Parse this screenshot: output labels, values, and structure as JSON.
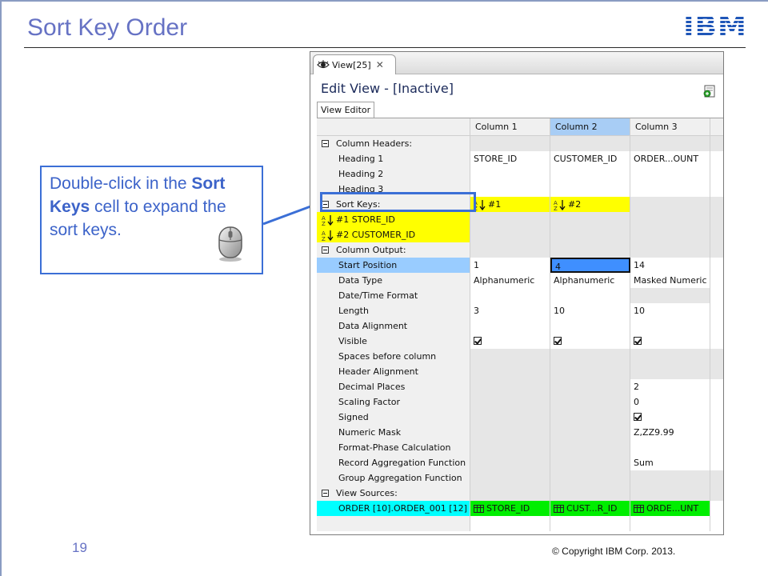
{
  "slide": {
    "title": "Sort Key Order",
    "logo_text": "IBM",
    "page_number": "19",
    "copyright": "© Copyright  IBM Corp. 2013."
  },
  "callout": {
    "text_1": "Double-click in the ",
    "bold_1": "Sort Keys",
    "text_2": " cell to expand the sort keys."
  },
  "app": {
    "tab_label": "View[25]",
    "tab_close": "✕",
    "edit_title": "Edit View - [Inactive]",
    "subtab_label": "View Editor",
    "columns": [
      "Column 1",
      "Column 2",
      "Column 3"
    ],
    "rows": {
      "column_headers": "Column Headers:",
      "heading1": "Heading 1",
      "heading1_values": [
        "STORE_ID",
        "CUSTOMER_ID",
        "ORDER...OUNT"
      ],
      "heading2": "Heading 2",
      "heading3": "Heading 3",
      "sort_keys": "Sort Keys:",
      "sort_key_col1": "#1",
      "sort_key_col2": "#2",
      "sort_key1": "#1 STORE_ID",
      "sort_key2": "#2 CUSTOMER_ID",
      "column_output": "Column Output:",
      "start_position": "Start Position",
      "start_position_values": [
        "1",
        "4",
        "14"
      ],
      "data_type": "Data Type",
      "data_type_values": [
        "Alphanumeric",
        "Alphanumeric",
        "Masked Numeric"
      ],
      "date_time_format": "Date/Time Format",
      "length": "Length",
      "length_values": [
        "3",
        "10",
        "10"
      ],
      "data_alignment": "Data Alignment",
      "visible": "Visible",
      "spaces_before": "Spaces before column",
      "header_alignment": "Header Alignment",
      "decimal_places": "Decimal Places",
      "decimal_places_value": "2",
      "scaling_factor": "Scaling Factor",
      "scaling_factor_value": "0",
      "signed": "Signed",
      "numeric_mask": "Numeric Mask",
      "numeric_mask_value": "Z,ZZ9.99",
      "format_phase": "Format-Phase Calculation",
      "record_agg": "Record Aggregation Function",
      "record_agg_value": "Sum",
      "group_agg": "Group Aggregation Function",
      "view_sources": "View Sources:",
      "view_source_label": "ORDER [10].ORDER_001 [12]",
      "view_source_values": [
        "STORE_ID",
        "CUST...R_ID",
        "ORDE...UNT"
      ]
    }
  },
  "colors": {
    "title": "#6672c4",
    "callout_border": "#3b6fd6",
    "sort_yellow": "#ffff00",
    "source_green": "#00ee00",
    "source_cyan": "#00ffff"
  }
}
